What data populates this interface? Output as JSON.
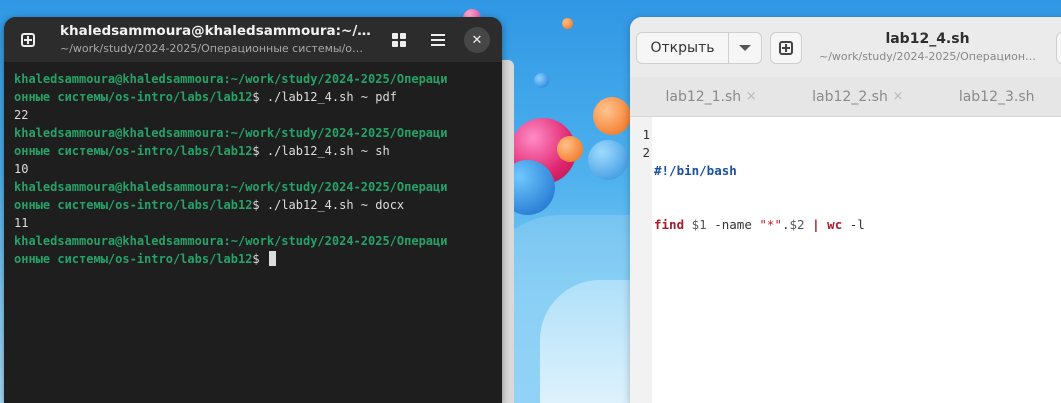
{
  "terminal": {
    "title": "khaledsammoura@khaledsammoura:~/wo…",
    "subtitle": "~/work/study/2024-2025/Операционные системы/o…",
    "prompt": "khaledsammoura@khaledsammoura:~/work/study/2024-2025/Операци",
    "prompt_cont": "онные системы/os-intro/labs/lab12",
    "lines": [
      {
        "cmd": "$ ./lab12_4.sh ~ pdf",
        "output": "22"
      },
      {
        "cmd": "$ ./lab12_4.sh ~ sh",
        "output": "10"
      },
      {
        "cmd": "$ ./lab12_4.sh ~ docx",
        "output": "11"
      }
    ],
    "final_prompt_symbol": "$"
  },
  "editor": {
    "open_label": "Открыть",
    "title": "lab12_4.sh",
    "subtitle": "~/work/study/2024-2025/Операцион…",
    "tabs": [
      {
        "label": "lab12_1.sh",
        "close": "×"
      },
      {
        "label": "lab12_2.sh",
        "close": "×"
      },
      {
        "label": "lab12_3.sh",
        "close": ""
      }
    ],
    "line_numbers": [
      "1",
      "2"
    ],
    "code": {
      "line1": "#!/bin/bash",
      "find": "find",
      "arg1": "$1",
      "name_opt": "-name",
      "pattern": "\"*\"",
      "dot": ".",
      "arg2": "$2",
      "pipe": "|",
      "wc": "wc",
      "wc_opt": "-l"
    }
  }
}
